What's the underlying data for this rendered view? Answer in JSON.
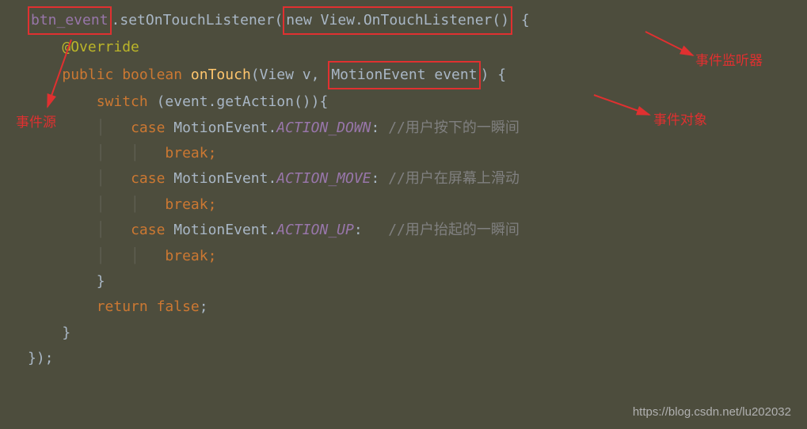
{
  "code": {
    "line1": {
      "var_btn": "btn_event",
      "method": ".setOnTouchListener(",
      "new_part": "new View.OnTouchListener()",
      "brace": " {"
    },
    "line2": {
      "override": "@Override"
    },
    "line3": {
      "public": "public ",
      "boolean": "boolean ",
      "on_touch": "onTouch",
      "params_start": "(View v, ",
      "motion_event": "MotionEvent event",
      "params_end": ") {"
    },
    "line4": {
      "switch": "switch ",
      "expr": "(event.getAction()){"
    },
    "line5": {
      "case": "case ",
      "motion": "MotionEvent.",
      "action": "ACTION_DOWN",
      "colon": ": ",
      "comment": "//用户按下的一瞬间"
    },
    "line6": {
      "break": "break;"
    },
    "line7": {
      "case": "case ",
      "motion": "MotionEvent.",
      "action": "ACTION_MOVE",
      "colon": ": ",
      "comment": "//用户在屏幕上滑动"
    },
    "line8": {
      "break": "break;"
    },
    "line9": {
      "case": "case ",
      "motion": "MotionEvent.",
      "action": "ACTION_UP",
      "colon": ":   ",
      "comment": "//用户抬起的一瞬间"
    },
    "line10": {
      "break": "break;"
    },
    "line11": {
      "brace": "}"
    },
    "line12": {
      "return": "return ",
      "false_val": "false",
      "semi": ";"
    },
    "line13": {
      "brace": "}"
    },
    "line14": {
      "end": "});"
    }
  },
  "labels": {
    "event_source": "事件源",
    "event_listener": "事件监听器",
    "event_object": "事件对象"
  },
  "watermark": "https://blog.csdn.net/lu202032"
}
